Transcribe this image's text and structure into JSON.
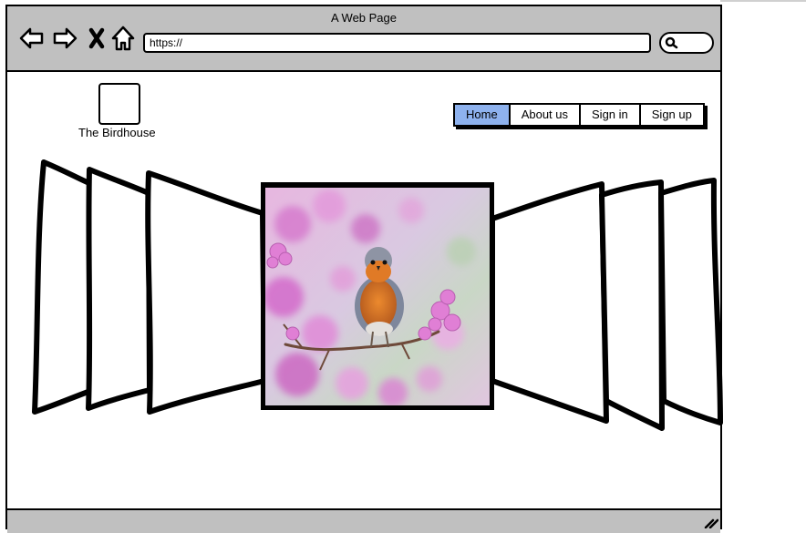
{
  "window": {
    "title": "A Web Page"
  },
  "browser": {
    "url": "https://",
    "buttons": [
      "back-icon",
      "forward-icon",
      "close-icon",
      "home-icon",
      "search-icon"
    ]
  },
  "site": {
    "logo_text": "The Birdhouse",
    "menu": [
      {
        "label": "Home",
        "active": true
      },
      {
        "label": "About us",
        "active": false
      },
      {
        "label": "Sign in",
        "active": false
      },
      {
        "label": "Sign up",
        "active": false
      }
    ]
  },
  "carousel": {
    "left_panels": 3,
    "right_panels": 3,
    "center_image": "robin-on-blossom-branch-image"
  },
  "colors": {
    "chrome": "#c0c0c0",
    "active_menu": "#8eb2ee",
    "border": "#000000"
  }
}
